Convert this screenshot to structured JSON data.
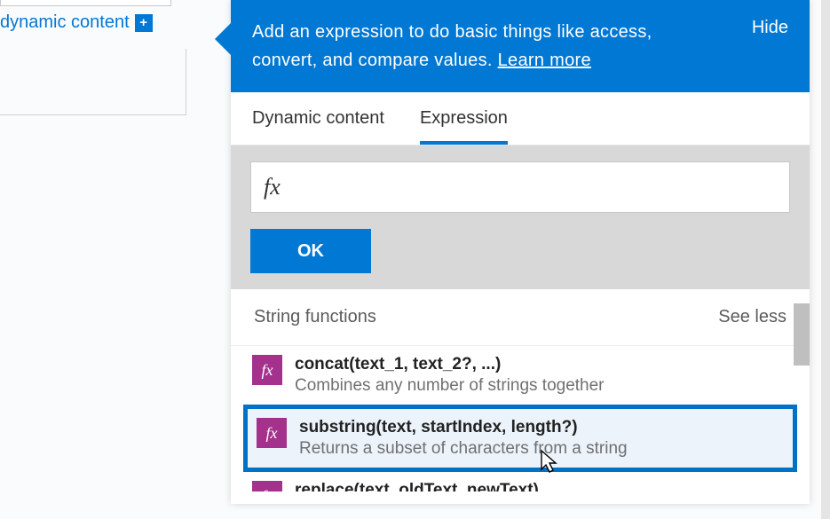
{
  "left": {
    "dynamic_content_label": "dynamic content"
  },
  "header": {
    "text_prefix": "Add an expression to do basic things like access, convert, and compare values. ",
    "learn_more": "Learn more",
    "hide": "Hide"
  },
  "tabs": {
    "dynamic": "Dynamic content",
    "expression": "Expression"
  },
  "expr": {
    "fx_label": "fx",
    "ok": "OK"
  },
  "group": {
    "title": "String functions",
    "toggle": "See less"
  },
  "functions": [
    {
      "icon": "fx",
      "sig": "concat(text_1, text_2?, ...)",
      "desc": "Combines any number of strings together"
    },
    {
      "icon": "fx",
      "sig": "substring(text, startIndex, length?)",
      "desc": "Returns a subset of characters from a string"
    },
    {
      "icon": "fx",
      "sig": "replace(text, oldText, newText)",
      "desc": ""
    }
  ]
}
